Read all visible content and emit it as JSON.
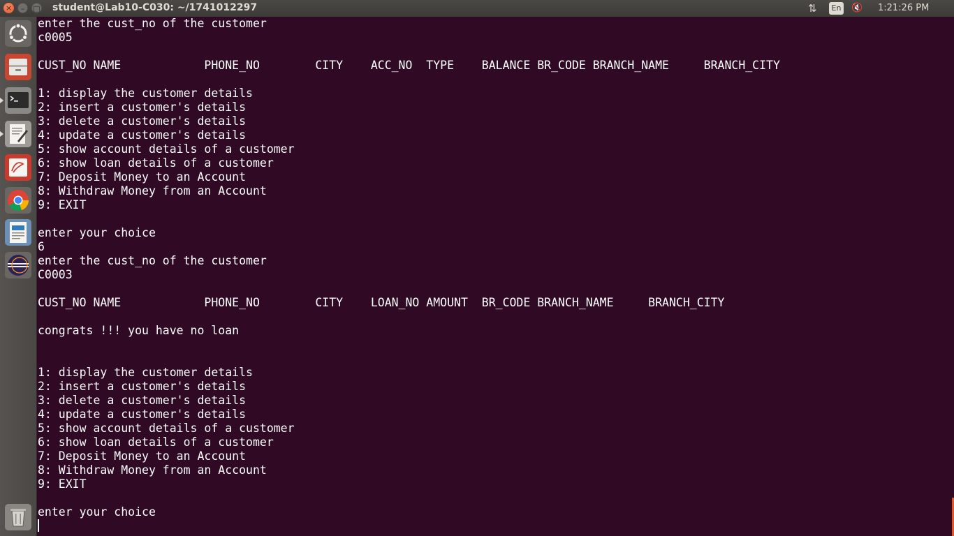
{
  "window": {
    "title": "student@Lab10-C030: ~/1741012297",
    "close_glyph": "×",
    "minimize_glyph": "–",
    "maximize_glyph": "□"
  },
  "panel": {
    "network_icon": "⇅",
    "keyboard_layout": "En",
    "volume_icon": "🔇",
    "clock": "1:21:26 PM"
  },
  "launcher": {
    "items": [
      {
        "name": "dash-home",
        "icon": "ubuntu-logo-icon",
        "color": "#5c5a57"
      },
      {
        "name": "files",
        "icon": "file-cabinet-icon",
        "color": "#c94630"
      },
      {
        "name": "terminal",
        "icon": "terminal-icon",
        "color": "#2b2b2b"
      },
      {
        "name": "text-editor",
        "icon": "text-editor-icon",
        "color": "#d4d0c8"
      },
      {
        "name": "pdf-viewer",
        "icon": "pdf-viewer-icon",
        "color": "#cc3a2e"
      },
      {
        "name": "chrome",
        "icon": "chrome-icon",
        "color": "#4285f4"
      },
      {
        "name": "writer",
        "icon": "document-writer-icon",
        "color": "#2f7bbf"
      },
      {
        "name": "eclipse",
        "icon": "eclipse-icon",
        "color": "#2c2255"
      },
      {
        "name": "trash",
        "icon": "trash-icon",
        "color": "#8a8782"
      }
    ]
  },
  "terminal": {
    "lines": [
      "enter the cust_no of the customer",
      "c0005",
      "",
      "CUST_NO NAME            PHONE_NO        CITY    ACC_NO  TYPE    BALANCE BR_CODE BRANCH_NAME     BRANCH_CITY",
      "",
      "1: display the customer details",
      "2: insert a customer's details",
      "3: delete a customer's details",
      "4: update a customer's details",
      "5: show account details of a customer",
      "6: show loan details of a customer",
      "7: Deposit Money to an Account",
      "8: Withdraw Money from an Account",
      "9: EXIT",
      "",
      "enter your choice",
      "6",
      "enter the cust_no of the customer",
      "C0003",
      "",
      "CUST_NO NAME            PHONE_NO        CITY    LOAN_NO AMOUNT  BR_CODE BRANCH_NAME     BRANCH_CITY",
      "",
      "congrats !!! you have no loan",
      "",
      "",
      "1: display the customer details",
      "2: insert a customer's details",
      "3: delete a customer's details",
      "4: update a customer's details",
      "5: show account details of a customer",
      "6: show loan details of a customer",
      "7: Deposit Money to an Account",
      "8: Withdraw Money from an Account",
      "9: EXIT",
      "",
      "enter your choice"
    ],
    "colors": {
      "background": "#300a24",
      "foreground": "#ffffff",
      "accent": "#e95420"
    }
  }
}
